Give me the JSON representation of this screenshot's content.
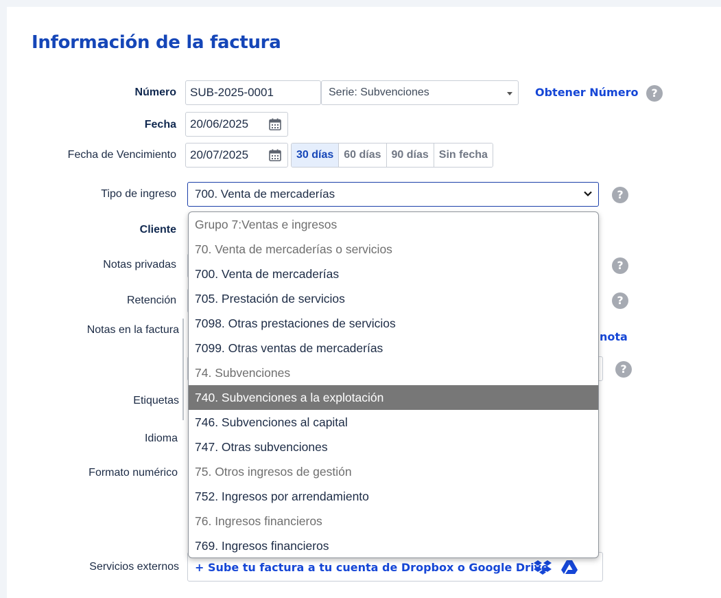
{
  "title": "Información de la factura",
  "labels": {
    "numero": "Número",
    "fecha": "Fecha",
    "vencimiento": "Fecha de Vencimiento",
    "tipo": "Tipo de ingreso",
    "cliente": "Cliente",
    "notas_privadas": "Notas privadas",
    "retencion": "Retención",
    "notas_factura": "Notas en la factura",
    "etiquetas": "Etiquetas",
    "idioma": "Idioma",
    "formato": "Formato numérico",
    "servicios": "Servicios externos"
  },
  "numero": {
    "value": "SUB-2025-0001",
    "serie": "Serie: Subvenciones",
    "obtener": "Obtener Número"
  },
  "fecha": {
    "value": "20/06/2025"
  },
  "vencimiento": {
    "value": "20/07/2025",
    "options": [
      "30 días",
      "60 días",
      "90 días",
      "Sin fecha"
    ],
    "active": "30 días"
  },
  "tipo": {
    "value": "700. Venta de mercaderías"
  },
  "notas_link": "nota",
  "help_glyph": "?",
  "dropdown": {
    "options": [
      {
        "label": "Grupo 7:Ventas e ingresos",
        "group": true
      },
      {
        "label": "70. Venta de mercaderías o servicios",
        "group": true
      },
      {
        "label": "700. Venta de mercaderías",
        "group": false
      },
      {
        "label": "705. Prestación de servicios",
        "group": false
      },
      {
        "label": "7098. Otras prestaciones de servicios",
        "group": false
      },
      {
        "label": "7099. Otras ventas de mercaderías",
        "group": false
      },
      {
        "label": "74. Subvenciones",
        "group": true
      },
      {
        "label": "740. Subvenciones a la explotación",
        "group": false,
        "highlighted": true
      },
      {
        "label": "746. Subvenciones al capital",
        "group": false
      },
      {
        "label": "747. Otras subvenciones",
        "group": false
      },
      {
        "label": "75. Otros ingresos de gestión",
        "group": true
      },
      {
        "label": "752. Ingresos por arrendamiento",
        "group": false
      },
      {
        "label": "76. Ingresos financieros",
        "group": true
      },
      {
        "label": "769. Ingresos financieros",
        "group": false
      }
    ]
  },
  "servicios": {
    "text": "+ Sube tu factura a tu cuenta de Dropbox o Google Drive",
    "icons": [
      "dropbox-icon",
      "google-drive-icon"
    ]
  },
  "colors": {
    "accent": "#1546b8",
    "link": "#1546d6",
    "highlight": "#777777"
  }
}
